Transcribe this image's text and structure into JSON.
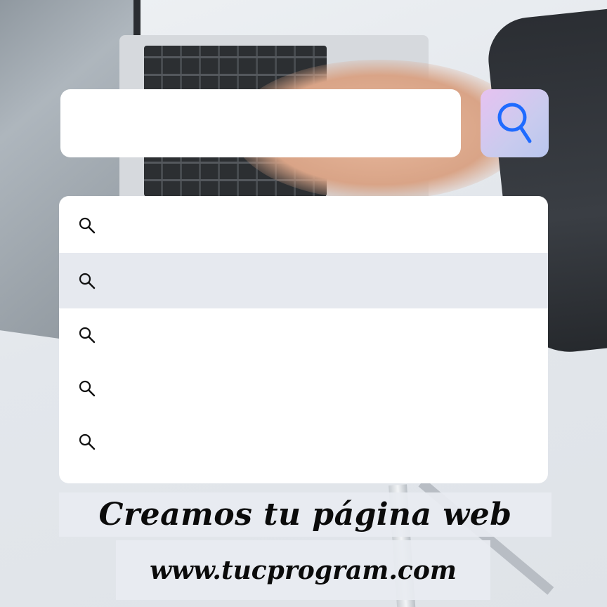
{
  "search": {
    "value": "",
    "button_icon": "magnifier-icon",
    "button_icon_color": "#1f6bff"
  },
  "suggestions": {
    "items": [
      {
        "icon": "search-icon",
        "text": ""
      },
      {
        "icon": "search-icon",
        "text": ""
      },
      {
        "icon": "search-icon",
        "text": ""
      },
      {
        "icon": "search-icon",
        "text": ""
      },
      {
        "icon": "search-icon",
        "text": ""
      }
    ],
    "highlighted_index": 1
  },
  "caption": {
    "headline": "Creamos tu página web",
    "url": "www.tucprogram.com"
  }
}
